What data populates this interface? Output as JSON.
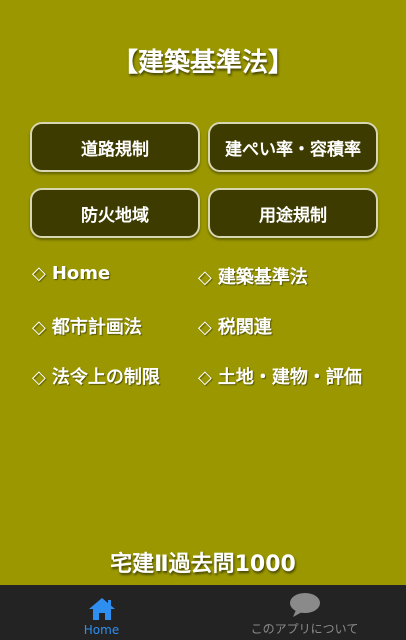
{
  "title": "【建築基準法】",
  "buttons": {
    "road": "道路規制",
    "ratio": "建ぺい率・容積率",
    "fire": "防火地域",
    "use": "用途規制"
  },
  "links": {
    "home": "Home",
    "building_standards": "建築基準法",
    "city_planning": "都市計画法",
    "tax": "税関連",
    "restrictions": "法令上の制限",
    "land_valuation": "土地・建物・評価"
  },
  "diamond": "◇",
  "footer_title": "宅建Ⅱ過去問1000",
  "tabs": {
    "home": "Home",
    "about": "このアプリについて"
  },
  "colors": {
    "background": "#9a9700",
    "button": "#3d3b00",
    "tab_active": "#2f8ff0",
    "tab_inactive": "#8a8a8a",
    "tabbar": "#232323"
  }
}
